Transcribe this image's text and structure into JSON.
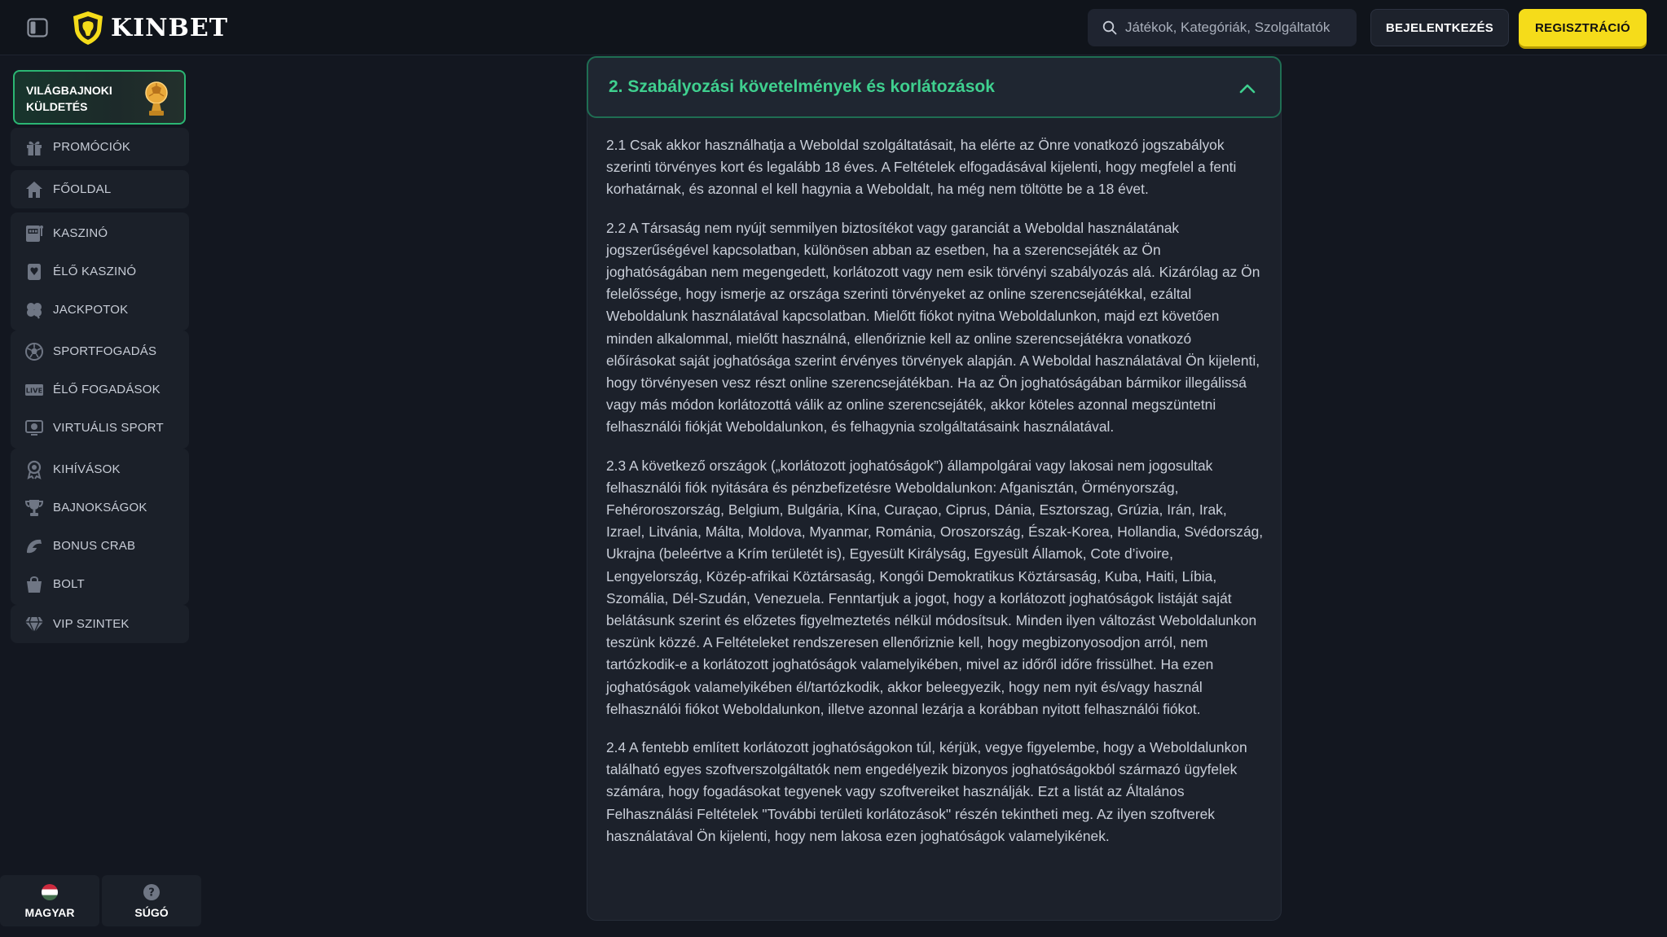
{
  "header": {
    "brand": "KINBET",
    "search_placeholder": "Játékok, Kategóriák, Szolgáltatók",
    "login_label": "BEJELENTKEZÉS",
    "register_label": "REGISZTRÁCIÓ"
  },
  "sidebar": {
    "promo_label": "VILÁGBAJNOKI KÜLDETÉS",
    "groups": [
      {
        "items": [
          {
            "label": "PROMÓCIÓK",
            "icon": "gift-icon"
          }
        ]
      },
      {
        "items": [
          {
            "label": "FŐOLDAL",
            "icon": "home-icon"
          }
        ]
      },
      {
        "items": [
          {
            "label": "KASZINÓ",
            "icon": "slot-machine-icon"
          },
          {
            "label": "ÉLŐ KASZINÓ",
            "icon": "playing-card-icon"
          },
          {
            "label": "JACKPOTOK",
            "icon": "clover-icon"
          }
        ]
      },
      {
        "items": [
          {
            "label": "SPORTFOGADÁS",
            "icon": "soccer-ball-icon"
          },
          {
            "label": "ÉLŐ FOGADÁSOK",
            "icon": "live-badge-icon"
          },
          {
            "label": "VIRTUÁLIS SPORT",
            "icon": "virtual-sport-icon"
          }
        ]
      },
      {
        "items": [
          {
            "label": "KIHÍVÁSOK",
            "icon": "medal-icon"
          },
          {
            "label": "BAJNOKSÁGOK",
            "icon": "trophy-icon"
          },
          {
            "label": "BONUS CRAB",
            "icon": "crab-claw-icon"
          },
          {
            "label": "BOLT",
            "icon": "shopping-bag-icon"
          }
        ]
      },
      {
        "items": [
          {
            "label": "VIP SZINTEK",
            "icon": "diamond-icon"
          }
        ]
      }
    ],
    "language_label": "MAGYAR",
    "help_label": "SÚGÓ"
  },
  "section": {
    "title": "2.  Szabályozási követelmények és korlátozások",
    "paragraphs": [
      "2.1 Csak akkor használhatja a Weboldal szolgáltatásait, ha elérte az Önre vonatkozó jogszabályok szerinti törvényes kort és legalább 18 éves. A Feltételek elfogadásával kijelenti, hogy megfelel a fenti korhatárnak, és azonnal el kell hagynia a Weboldalt, ha még nem töltötte be a 18 évet.",
      "2.2 A Társaság nem nyújt semmilyen biztosítékot vagy garanciát a Weboldal használatának jogszerűségével kapcsolatban, különösen abban az esetben, ha a szerencsejáték az Ön joghatóságában nem megengedett, korlátozott vagy nem esik törvényi szabályozás alá. Kizárólag az Ön felelőssége, hogy ismerje az országa szerinti törvényeket az online szerencsejátékkal, ezáltal Weboldalunk használatával kapcsolatban. Mielőtt fiókot nyitna Weboldalunkon, majd ezt követően minden alkalommal, mielőtt használná, ellenőriznie kell az online szerencsejátékra vonatkozó előírásokat saját joghatósága szerint érvényes törvények alapján. A Weboldal használatával Ön kijelenti, hogy törvényesen vesz részt online szerencsejátékban. Ha az Ön joghatóságában bármikor illegálissá vagy más módon korlátozottá válik az online szerencsejáték, akkor köteles azonnal megszüntetni felhasználói fiókját Weboldalunkon, és felhagynia szolgáltatásaink használatával.",
      "2.3 A következő országok („korlátozott joghatóságok”) állampolgárai vagy lakosai nem jogosultak felhasználói fiók nyitására és pénzbefizetésre Weboldalunkon: Afganisztán, Örményország, Fehéroroszország, Belgium, Bulgária, Kína, Curaçao, Ciprus, Dánia, Esztorszag, Grúzia, Irán, Irak, Izrael, Litvánia, Málta, Moldova, Myanmar, Románia, Oroszország, Észak-Korea, Hollandia, Svédország, Ukrajna (beleértve a Krím területét is), Egyesült Királyság, Egyesült Államok, Cote d’ivoire, Lengyelország, Közép-afrikai Köztársaság, Kongói Demokratikus Köztársaság, Kuba, Haiti, Líbia, Szomália, Dél-Szudán, Venezuela. Fenntartjuk a jogot, hogy a korlátozott joghatóságok listáját saját belátásunk szerint és előzetes figyelmeztetés nélkül módosítsuk. Minden ilyen változást Weboldalunkon teszünk közzé. A Feltételeket rendszeresen ellenőriznie kell, hogy megbizonyosodjon arról, nem tartózkodik-e a korlátozott joghatóságok valamelyikében, mivel az időről időre frissülhet. Ha ezen joghatóságok valamelyikében él/tartózkodik, akkor beleegyezik, hogy nem nyit és/vagy használ felhasználói fiókot Weboldalunkon, illetve azonnal lezárja a korábban nyitott felhasználói fiókot.",
      "2.4 A fentebb említett korlátozott joghatóságokon túl, kérjük, vegye figyelembe, hogy a Weboldalunkon található egyes szoftverszolgáltatók nem engedélyezik bizonyos joghatóságokból származó ügyfelek számára, hogy fogadásokat tegyenek vagy szoftvereiket használják. Ezt a listát az Általános Felhasználási Feltételek \"További területi korlátozások\" részén tekintheti meg. Az ilyen szoftverek használatával Ön kijelenti, hogy nem lakosa ezen joghatóságok valamelyikének."
    ]
  },
  "colors": {
    "accent_green": "#3fd08f",
    "brand_yellow": "#f5dc1a",
    "background": "#131720"
  }
}
